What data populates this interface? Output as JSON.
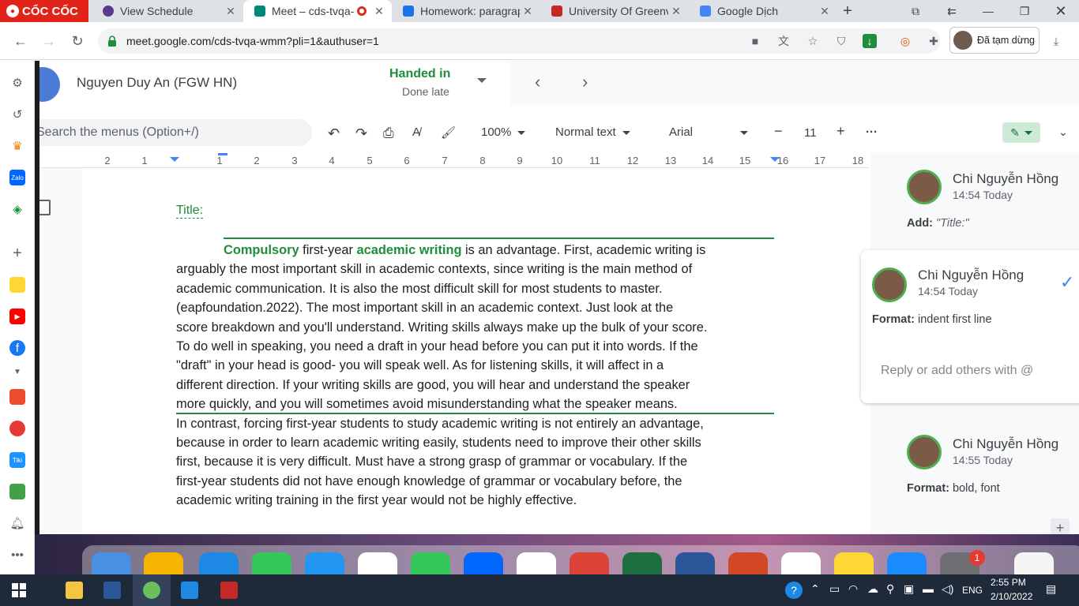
{
  "browser": {
    "brand": "CỐC CỐC",
    "tabs": [
      {
        "title": "View Schedule",
        "icon": "fgw-icon",
        "color": "#5b3a8e"
      },
      {
        "title": "Meet – cds-tvqa-",
        "icon": "google-meet-icon",
        "color": "#00897b",
        "active": true
      },
      {
        "title": "Homework: paragrap",
        "icon": "classroom-icon",
        "color": "#1a73e8"
      },
      {
        "title": "University Of Greenv",
        "icon": "greenwich-icon",
        "color": "#c62828"
      },
      {
        "title": "Google Dịch",
        "icon": "google-translate-icon",
        "color": "#4285f4"
      }
    ],
    "url": "meet.google.com/cds-tvqa-wmm?pli=1&authuser=1",
    "profile_label": "Đã tạm dừng"
  },
  "classroom": {
    "student_name": "Nguyen Duy An (FGW HN)",
    "status_main": "Handed in",
    "status_sub": "Done late"
  },
  "doc_toolbar": {
    "menu_search": "Search the menus (Option+/)",
    "zoom": "100%",
    "style": "Normal text",
    "font": "Arial",
    "font_size": "11",
    "minus": "−",
    "plus": "+",
    "more": "···"
  },
  "ruler": [
    "2",
    "1",
    "1",
    "2",
    "3",
    "4",
    "5",
    "6",
    "7",
    "8",
    "9",
    "10",
    "11",
    "12",
    "13",
    "14",
    "15",
    "16",
    "17",
    "18"
  ],
  "document": {
    "title": "Title:",
    "lines": [
      [
        "",
        "Compulsory",
        " first-year ",
        "academic writing",
        " is an advantage. First, academic writing is"
      ],
      "arguably the most important skill in academic contexts, since writing is the main method of",
      "academic communication. It is also the most difficult skill for most students to master.",
      "(eapfoundation.2022). The most important skill in an academic context. Just look at the",
      "score breakdown and you'll understand. Writing skills always make up the bulk of your score.",
      "To do well in speaking, you need a draft in your head before you can put it into words. If the",
      "\"draft\" in your head is good- you will speak well. As for listening skills, it will affect in a",
      "different direction. If your writing skills are good, you will hear and understand the speaker",
      "more quickly, and you will sometimes avoid misunderstanding what the speaker means.",
      "In contrast, forcing first-year students to study academic writing is not entirely an advantage,",
      "because in order to learn academic writing easily, students need to improve their other skills",
      "first, because it is very difficult. Must have a strong grasp of grammar or vocabulary. If the",
      "first-year students did not have enough knowledge of grammar or vocabulary before, the",
      "academic writing training in the first year would not be highly effective."
    ]
  },
  "comments": [
    {
      "author": "Chi Nguyễn Hồng",
      "time": "14:54 Today",
      "label": "Add:",
      "value": "\"Title:\""
    },
    {
      "author": "Chi Nguyễn Hồng",
      "time": "14:54 Today",
      "label": "Format:",
      "value": "indent first line",
      "reply_placeholder": "Reply or add others with @"
    },
    {
      "author": "Chi Nguyễn Hồng",
      "time": "14:55 Today",
      "label": "Format:",
      "value": "bold, font"
    }
  ],
  "dock": {
    "badge": "1"
  },
  "taskbar": {
    "lang": "ENG",
    "time": "2:55 PM",
    "date": "2/10/2022"
  },
  "colors": {
    "accent_green": "#1e8e3e",
    "brand_red": "#e2231a"
  }
}
